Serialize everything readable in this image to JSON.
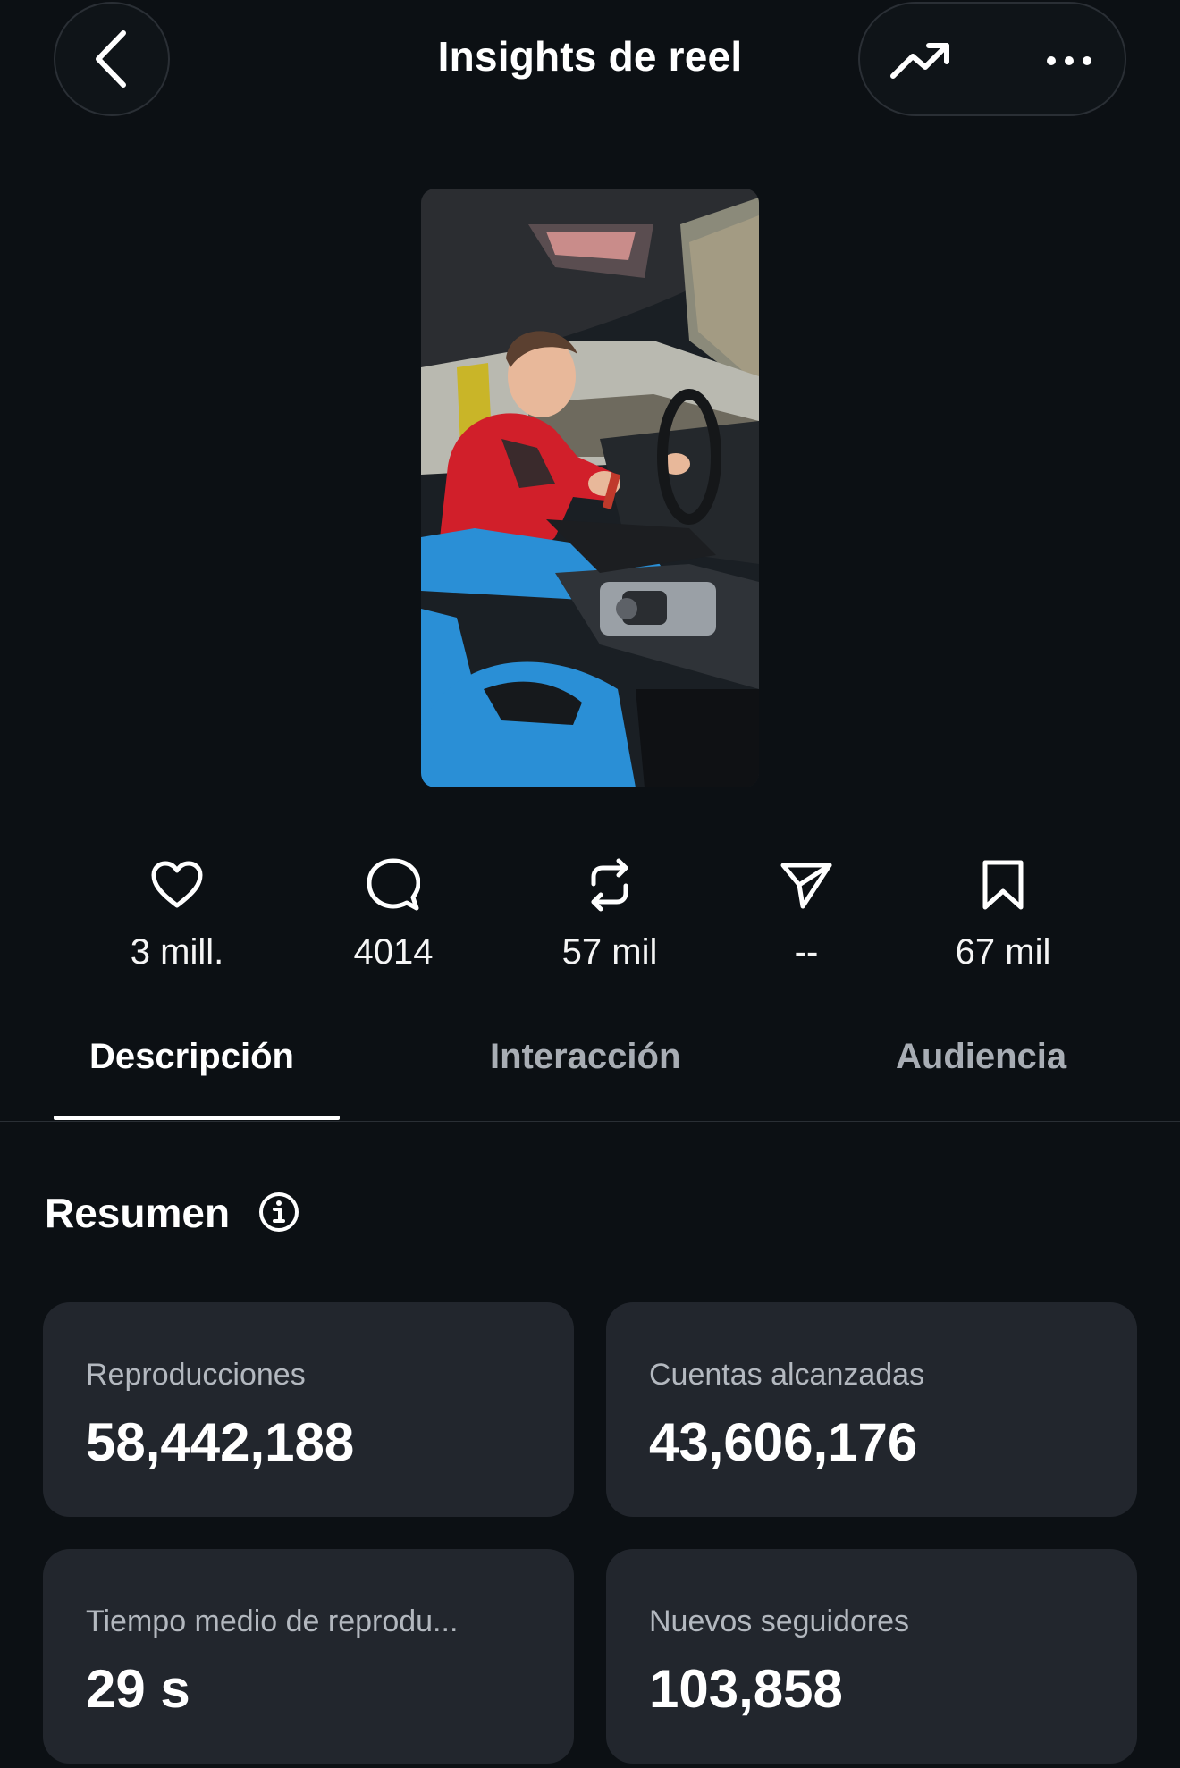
{
  "header": {
    "title": "Insights de reel"
  },
  "stats": [
    {
      "icon": "heart-icon",
      "value": "3 mill."
    },
    {
      "icon": "comment-icon",
      "value": "4014"
    },
    {
      "icon": "repost-icon",
      "value": "57 mil"
    },
    {
      "icon": "share-icon",
      "value": "--"
    },
    {
      "icon": "bookmark-icon",
      "value": "67 mil"
    }
  ],
  "tabs": [
    {
      "label": "Descripción",
      "active": true
    },
    {
      "label": "Interacción",
      "active": false
    },
    {
      "label": "Audiencia",
      "active": false
    }
  ],
  "summary": {
    "title": "Resumen",
    "cards": [
      {
        "label": "Reproducciones",
        "value": "58,442,188"
      },
      {
        "label": "Cuentas alcanzadas",
        "value": "43,606,176"
      },
      {
        "label": "Tiempo medio de reprodu...",
        "value": "29 s"
      },
      {
        "label": "Nuevos seguidores",
        "value": "103,858"
      }
    ]
  },
  "colors": {
    "background": "#0c1014",
    "card": "#22262d",
    "muted_text": "#b3b8bf",
    "accent_red": "#d11f2a",
    "seat_blue": "#2a8fd6"
  }
}
